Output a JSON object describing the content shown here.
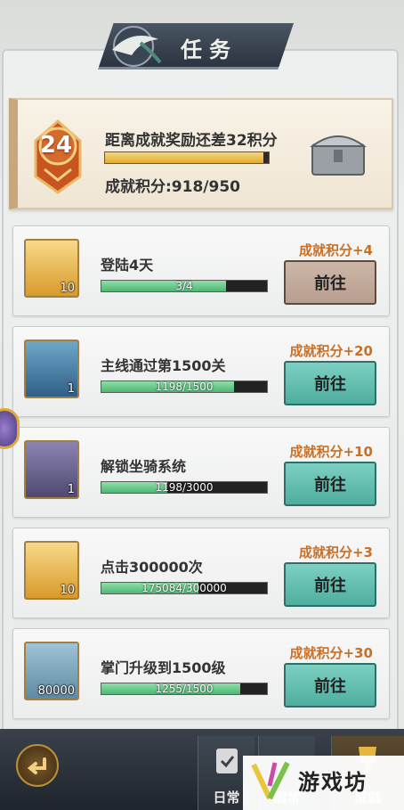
{
  "title": "任务",
  "progress_card": {
    "level": "24",
    "remaining_text": "距离成就奖励还差32积分",
    "score_text": "成就积分:918/950",
    "progress": 0.966
  },
  "tasks": [
    {
      "name": "登陆4天",
      "progress_text": "3/4",
      "progress": 0.75,
      "reward": "成就积分+4",
      "button": "前往",
      "count": "10",
      "icon": "gold-ingot-icon",
      "button_style": "brown"
    },
    {
      "name": "主线通过第1500关",
      "progress_text": "1198/1500",
      "progress": 0.799,
      "reward": "成就积分+20",
      "button": "前往",
      "count": "1",
      "icon": "golden-token-icon",
      "button_style": "teal"
    },
    {
      "name": "解锁坐骑系统",
      "progress_text": "1198/3000",
      "progress": 0.399,
      "reward": "成就积分+10",
      "button": "前往",
      "count": "1",
      "icon": "white-horse-icon",
      "button_style": "teal"
    },
    {
      "name": "点击300000次",
      "progress_text": "175084/300000",
      "progress": 0.584,
      "reward": "成就积分+3",
      "button": "前往",
      "count": "10",
      "icon": "gold-ingot-icon",
      "button_style": "teal"
    },
    {
      "name": "掌门升级到1500级",
      "progress_text": "1255/1500",
      "progress": 0.837,
      "reward": "成就积分+30",
      "button": "前往",
      "count": "80000",
      "icon": "silver-coin-icon",
      "button_style": "teal"
    }
  ],
  "nav": {
    "daily": "日常",
    "weekly": "周常",
    "achievement": "成就"
  },
  "watermark": "游戏坊",
  "colors": {
    "reward": "#c96f26",
    "bar_green": "#4fb575",
    "button_teal": "#4fae9f",
    "button_brown": "#b89e8e"
  }
}
